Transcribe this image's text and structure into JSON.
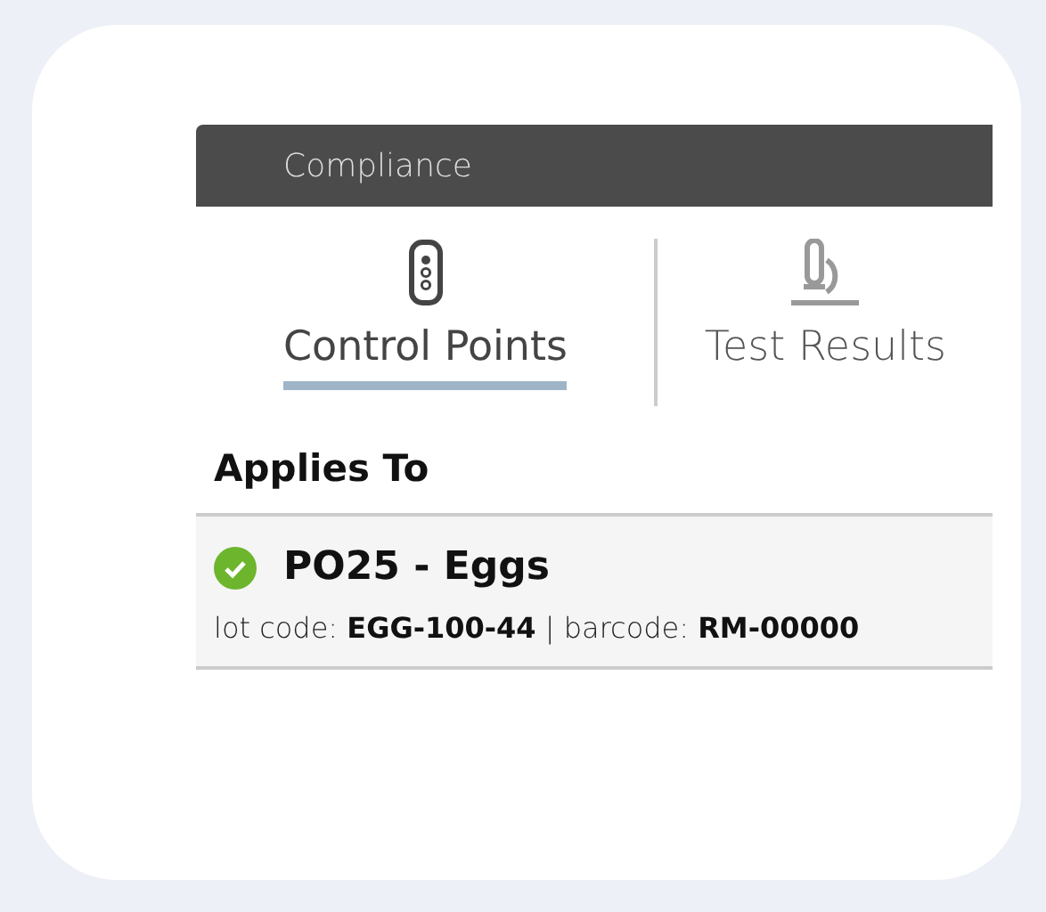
{
  "header": {
    "title": "Compliance"
  },
  "tabs": [
    {
      "label": "Control Points",
      "selected": true
    },
    {
      "label": "Test Results",
      "selected": false
    }
  ],
  "applies_to": {
    "heading": "Applies To",
    "items": [
      {
        "name": "PO25 - Eggs",
        "approved": true,
        "details": "lot code: **EGG-100-44** | barcode: **RM-00000**"
      }
    ]
  }
}
